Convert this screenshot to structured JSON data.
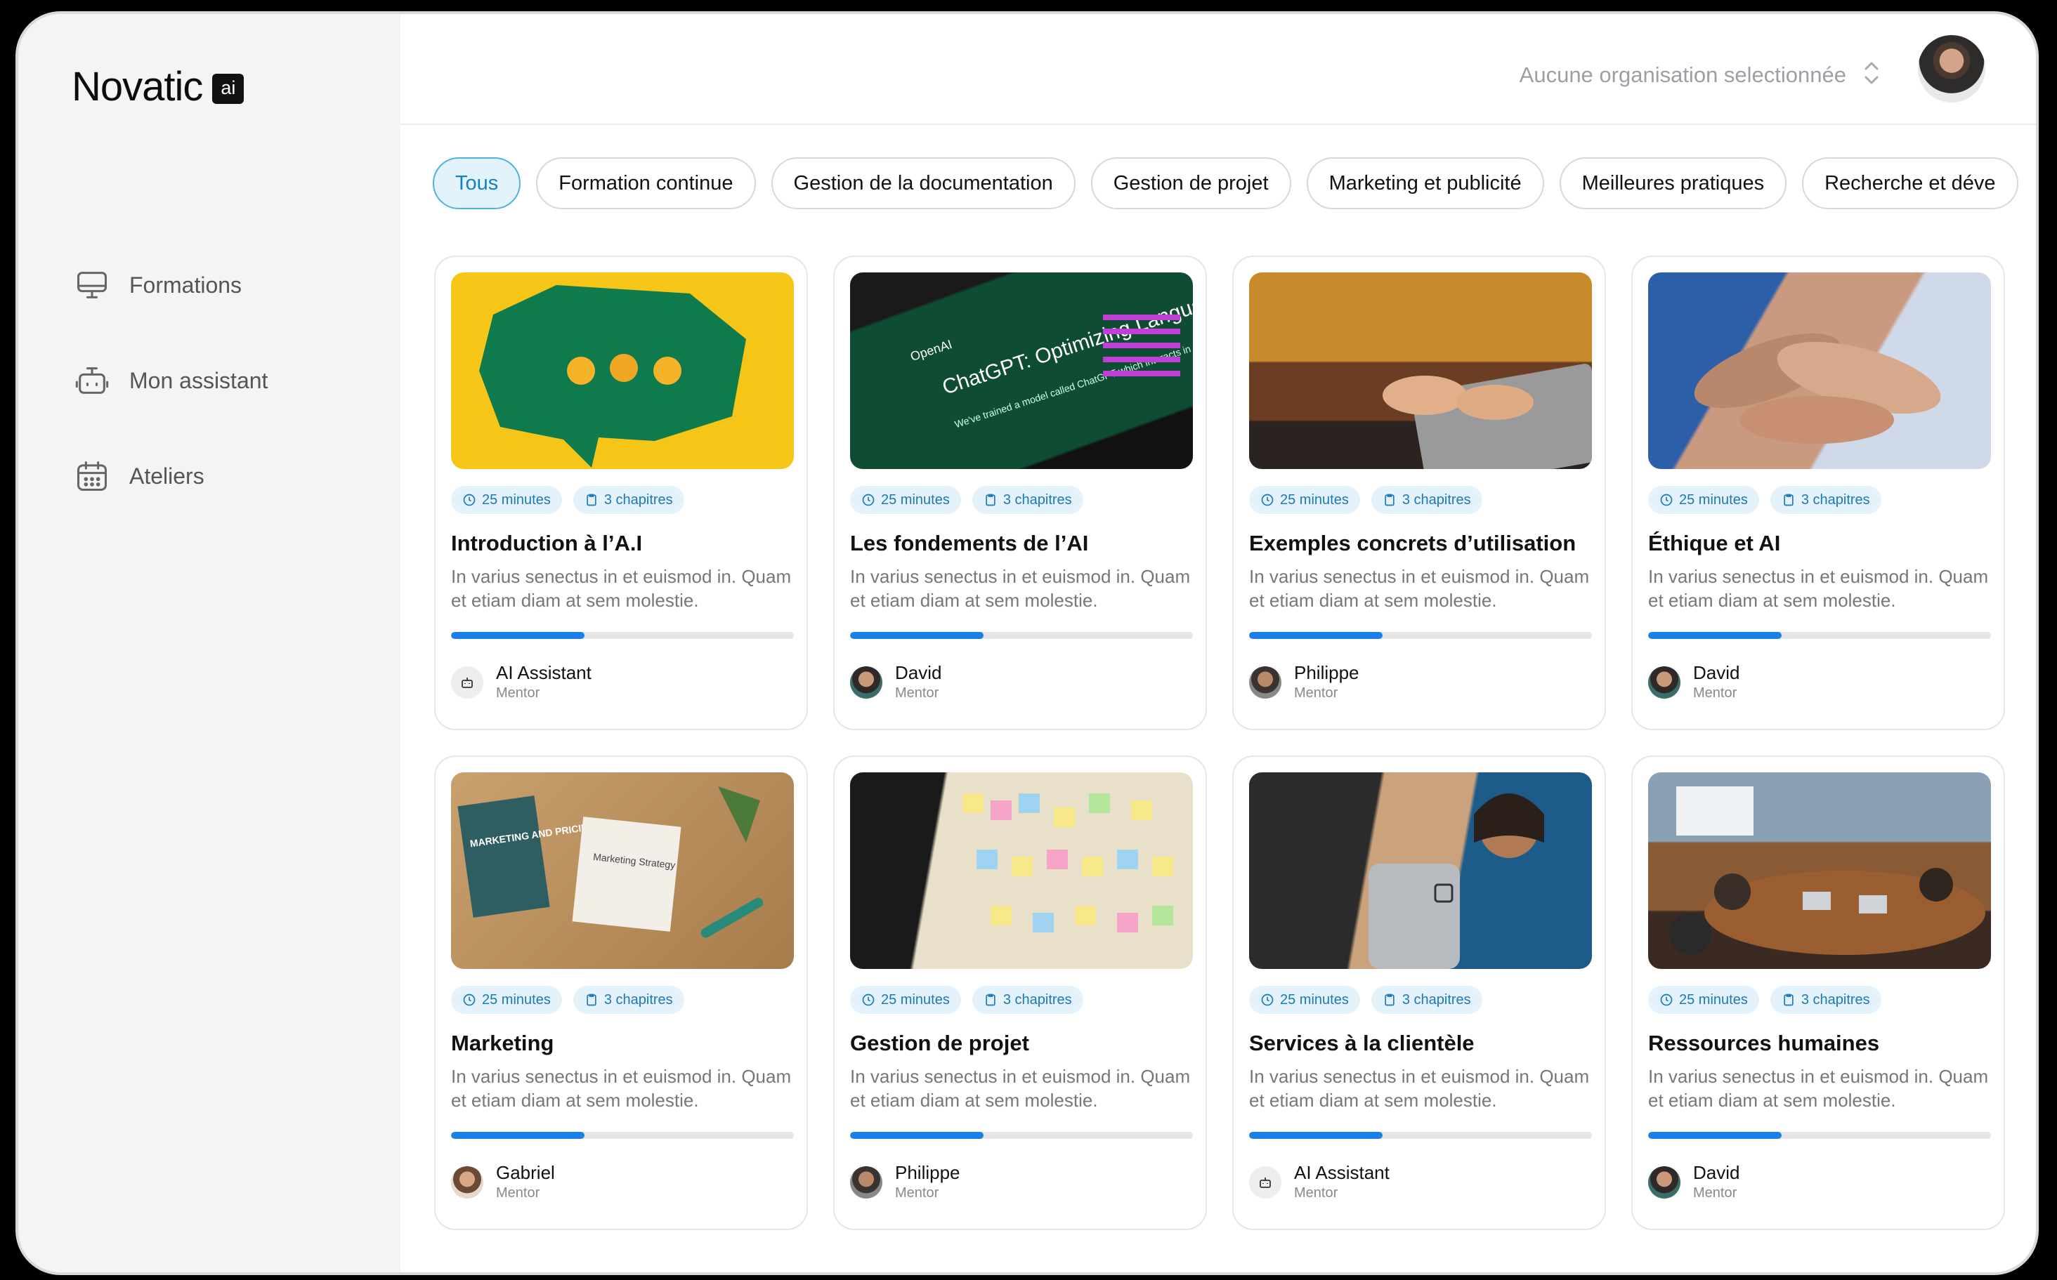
{
  "brand": {
    "name": "Novatic",
    "badge": "ai"
  },
  "sidebar": {
    "items": [
      {
        "label": "Formations",
        "icon": "monitor-icon"
      },
      {
        "label": "Mon assistant",
        "icon": "robot-icon"
      },
      {
        "label": "Ateliers",
        "icon": "calendar-icon"
      }
    ]
  },
  "header": {
    "org_select": "Aucune organisation selectionnée"
  },
  "chips": [
    "Tous",
    "Formation continue",
    "Gestion de la documentation",
    "Gestion de projet",
    "Marketing et publicité",
    "Meilleures pratiques",
    "Recherche et déve"
  ],
  "cards": [
    {
      "title": "Introduction à l’A.I",
      "duration": "25 minutes",
      "chapters": "3 chapitres",
      "desc": "In varius senectus in et euismod in. Quam et etiam diam at sem molestie.",
      "progress": 0.39,
      "mentor": "AI Assistant",
      "role": "Mentor"
    },
    {
      "title": "Les fondements de l’AI",
      "duration": "25 minutes",
      "chapters": "3 chapitres",
      "desc": "In varius senectus in et euismod in. Quam et etiam diam at sem molestie.",
      "progress": 0.39,
      "mentor": "David",
      "role": "Mentor"
    },
    {
      "title": "Exemples concrets d’utilisation",
      "duration": "25 minutes",
      "chapters": "3 chapitres",
      "desc": "In varius senectus in et euismod in. Quam et etiam diam at sem molestie.",
      "progress": 0.39,
      "mentor": "Philippe",
      "role": "Mentor"
    },
    {
      "title": "Éthique et AI",
      "duration": "25 minutes",
      "chapters": "3 chapitres",
      "desc": "In varius senectus in et euismod in. Quam et etiam diam at sem molestie.",
      "progress": 0.39,
      "mentor": "David",
      "role": "Mentor"
    },
    {
      "title": "Marketing",
      "duration": "25 minutes",
      "chapters": "3 chapitres",
      "desc": "In varius senectus in et euismod in. Quam et etiam diam at sem molestie.",
      "progress": 0.39,
      "mentor": "Gabriel",
      "role": "Mentor"
    },
    {
      "title": "Gestion de projet",
      "duration": "25 minutes",
      "chapters": "3 chapitres",
      "desc": "In varius senectus in et euismod in. Quam et etiam diam at sem molestie.",
      "progress": 0.39,
      "mentor": "Philippe",
      "role": "Mentor"
    },
    {
      "title": "Services à la clientèle",
      "duration": "25 minutes",
      "chapters": "3 chapitres",
      "desc": "In varius senectus in et euismod in. Quam et etiam diam at sem molestie.",
      "progress": 0.39,
      "mentor": "AI Assistant",
      "role": "Mentor"
    },
    {
      "title": "Ressources humaines",
      "duration": "25 minutes",
      "chapters": "3 chapitres",
      "desc": "In varius senectus in et euismod in. Quam et etiam diam at sem molestie.",
      "progress": 0.39,
      "mentor": "David",
      "role": "Mentor"
    }
  ],
  "thumb_texts": {
    "openai_logo": "OpenAI",
    "openai_headline": "ChatGPT: Optimizing Language Models for Dialogue",
    "openai_sub": "We've trained a model called ChatGPT which interacts in a",
    "book": "MARKETING AND PRICING",
    "note": "Marketing Strategy"
  },
  "colors": {
    "accent": "#1a7fe6",
    "chip_active_bg": "#e3f3fb",
    "chip_active_text": "#1480c4",
    "tag_bg": "#e4f3fb"
  }
}
